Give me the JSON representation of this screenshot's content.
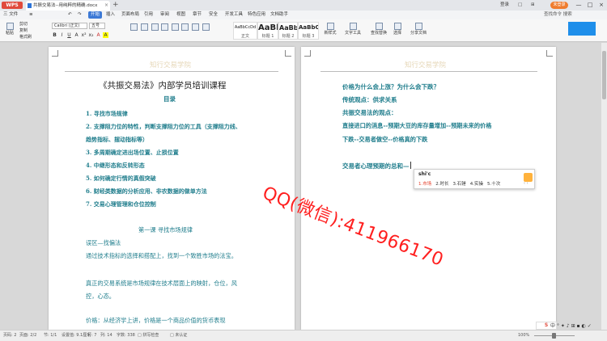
{
  "titlebar": {
    "app_name": "WPS",
    "doc_tab": "共振交易法--用纯粹的精确.docx",
    "tab_close": "×",
    "new_tab": "+",
    "right_texts": [
      "登录",
      "□",
      "⊞"
    ],
    "login": "未登录",
    "window_controls": [
      "—",
      "□",
      "×"
    ]
  },
  "menubar": {
    "items": [
      "三 文件",
      "≡",
      "↶",
      "↷"
    ],
    "start": "开始",
    "tabs": [
      "插入",
      "页面布局",
      "引用",
      "审阅",
      "视图",
      "章节",
      "安全",
      "开发工具",
      "特色应用",
      "文档助手"
    ],
    "search": "查找命令 搜索"
  },
  "ribbon": {
    "paste": "粘贴",
    "cut": "剪切",
    "copy": "复制",
    "format_painter": "格式刷",
    "font_name": "Calibri (正文)",
    "font_size": "五号",
    "format_buttons": [
      "B",
      "I",
      "U",
      "A",
      "x²",
      "x₂",
      "A",
      "A"
    ],
    "styles": [
      {
        "sample": "AaBbCcDd",
        "label": "正文"
      },
      {
        "sample": "AaBb",
        "label": "标题 1"
      },
      {
        "sample": "AaBb(",
        "label": "标题 2"
      },
      {
        "sample": "AaBbC",
        "label": "标题 3"
      }
    ],
    "new_style": "新样式",
    "text_tools": "文字工具",
    "find_replace": "查找替换",
    "select": "选择",
    "share": "分享文档"
  },
  "page_left": {
    "header": "知行交易学院",
    "title": "《共振交易法》内部学员培训课程",
    "toc_heading": "目录",
    "toc": [
      "1. 寻找市场规律",
      "2. 支撑阻力位的特性，判断支撑阻力位的工具（支撑阻力线、",
      "趋势指标、摆动指标等）",
      "3. 多周期确定进出场位置、止损位置",
      "4. 中继形态和反转形态",
      "5. 如何确定行情的真假突破",
      "6. 财经类数据的分析应用、非农数据的做单方法",
      "7. 交易心理管理和仓位控制"
    ],
    "lesson_title": "第一课    寻找市场规律",
    "body": [
      "误区—找偏法",
      "    通过技术指标的选择和搭配上，找到一个致胜市场的法宝。",
      "真正的交易系统是市场规律在技术层面上的映射，仓位，风",
      "控，心态。",
      "价格：从经济学上讲，价格是一个商品价值的货币表现"
    ]
  },
  "page_right": {
    "header": "知行交易学院",
    "lines": [
      "价格为什么会上涨？为什么会下跌？",
      "传统观点：供求关系",
      "共振交易法的观点：",
      "直接进口的消息--预期大豆的库存量增加--预期未来的价格",
      "下跌--交易者做空--价格真的下跌",
      "交易者心理预期的总和—"
    ]
  },
  "ime": {
    "pinyin": "shi'c",
    "candidates": [
      "1.市场",
      "2.时长",
      "3.石锤",
      "4.实操",
      "5.十次"
    ],
    "arrows": "‹  ›"
  },
  "watermark": "QQ(微信):411966170",
  "statusbar": {
    "left": [
      "页码: 2",
      "页面: 2/2",
      "节: 1/1",
      "设置值: 9.1厘米",
      "行: 7",
      "列: 14",
      "字数: 338",
      "□ 拼写检查",
      "□ 未认证"
    ],
    "zoom": "100%",
    "tray": [
      "中",
      "°",
      "✦",
      "♪",
      "⊞",
      "▪",
      "◐",
      "✓"
    ],
    "tray_logo": "S"
  },
  "colors": {
    "doc_text": "#1f7d8c",
    "watermark": "#ff1f1f",
    "accent": "#3c79d6",
    "header": "#e6d7b8"
  }
}
